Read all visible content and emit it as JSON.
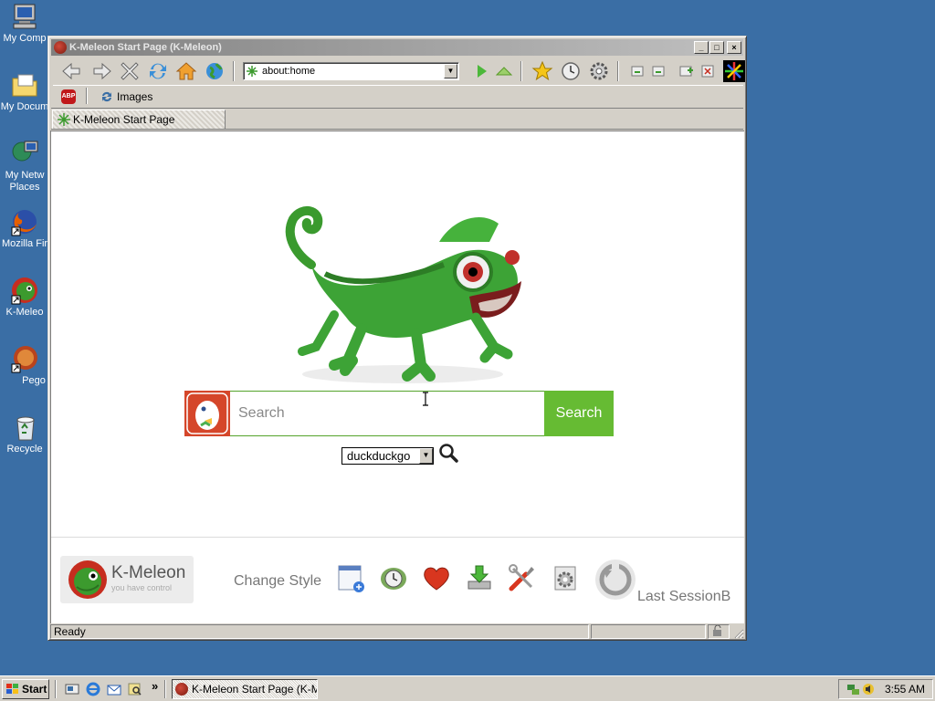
{
  "desktop": {
    "icons": [
      {
        "label": "My Comp",
        "icon": "my-computer-icon"
      },
      {
        "label": "My Docum",
        "icon": "my-documents-icon"
      },
      {
        "label": "My Netw",
        "label2": "Places",
        "icon": "network-places-icon"
      },
      {
        "label": "Mozilla Fir",
        "icon": "firefox-icon"
      },
      {
        "label": "K-Meleo",
        "icon": "kmeleon-icon"
      },
      {
        "label": "Pego",
        "icon": "pego-icon"
      },
      {
        "label": "Recycle",
        "icon": "recycle-bin-icon"
      }
    ]
  },
  "window": {
    "title": "K-Meleon Start Page (K-Meleon)",
    "buttons": {
      "minimize": "_",
      "maximize": "□",
      "close": "×"
    }
  },
  "toolbar": {
    "url": "about:home",
    "images_label": "Images",
    "abp_label": "ABP"
  },
  "tab": {
    "label": "K-Meleon Start Page"
  },
  "content": {
    "search": {
      "placeholder": "Search",
      "button": "Search"
    },
    "engine": "duckduckgo",
    "brand": {
      "name": "K-Meleon",
      "tagline": "you have control"
    },
    "change_style": "Change Style",
    "last_session": "Last SessionB"
  },
  "statusbar": {
    "text": "Ready"
  },
  "taskbar": {
    "start": "Start",
    "task": "K-Meleon Start Page (K-M...",
    "clock": "3:55 AM",
    "chevron": "»"
  },
  "colors": {
    "desktop": "#3a6ea5",
    "search_green": "#66bb33",
    "ddg_orange": "#d5462a"
  }
}
